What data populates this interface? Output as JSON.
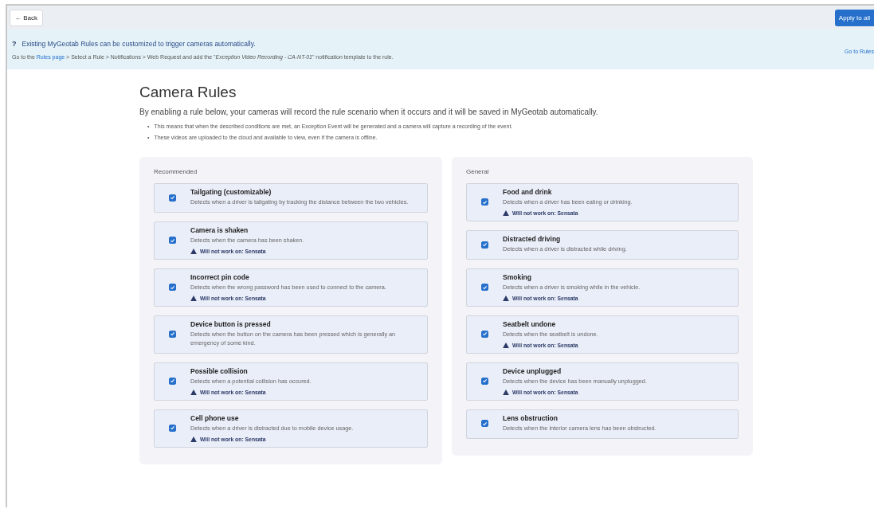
{
  "toolbar": {
    "back_button": "← Back",
    "apply_button": "Apply to all"
  },
  "banner": {
    "icon": "?",
    "headline": "Existing MyGeotab Rules can be customized to trigger cameras automatically.",
    "text_before": "Go to the ",
    "link": "Rules page",
    "text_after": " > Select a Rule > Notifications > Web Request and add the \"*Exception Video Recording - CA-NT-01*\" notification template to the rule.",
    "action_link": "Go to Rules"
  },
  "title": "Camera Rules",
  "subtitle": "By enabling a rule below, your cameras will record the rule scenario when it occurs and it will be saved in MyGeotab automatically.",
  "bullet_marker": "•",
  "bullets": [
    "This means that when the described conditions are met, an Exception Event will be generated and a camera will capture a recording of the event.",
    "These videos are uploaded to the cloud and available to view, even if the camera is offline."
  ],
  "groups": [
    {
      "heading": "Recommended",
      "rules": [
        {
          "name": "Tailgating (customizable)",
          "description": "Detects when a driver is tailgating by tracking the distance between the two vehicles.",
          "checked": true
        },
        {
          "name": "Camera is shaken",
          "description": "Detects when the camera has been shaken.",
          "warning": "Will not work on: Sensata",
          "checked": true
        },
        {
          "name": "Incorrect pin code",
          "description": "Detects when the wrong password has been used to connect to the camera.",
          "warning": "Will not work on: Sensata",
          "checked": true
        },
        {
          "name": "Device button is pressed",
          "description": "Detects when the button on the camera has been pressed which is generally an emergency of some kind.",
          "checked": true
        },
        {
          "name": "Possible collision",
          "description": "Detects when a potential collision has occured.",
          "warning": "Will not work on: Sensata",
          "checked": true
        },
        {
          "name": "Cell phone use",
          "description": "Detects when a driver is distracted due to mobile device usage.",
          "warning": "Will not work on: Sensata",
          "checked": true
        }
      ]
    },
    {
      "heading": "General",
      "rules": [
        {
          "name": "Food and drink",
          "description": "Detects when a driver has been eating or drinking.",
          "warning": "Will not work on: Sensata",
          "checked": true
        },
        {
          "name": "Distracted driving",
          "description": "Detects when a driver is distracted while driving.",
          "checked": true
        },
        {
          "name": "Smoking",
          "description": "Detects when a driver is smoking while in the vehicle.",
          "warning": "Will not work on: Sensata",
          "checked": true
        },
        {
          "name": "Seatbelt undone",
          "description": "Detects when the seatbelt is undone.",
          "warning": "Will not work on: Sensata",
          "checked": true
        },
        {
          "name": "Device unplugged",
          "description": "Detects when the device has been manually unplugged.",
          "warning": "Will not work on: Sensata",
          "checked": true
        },
        {
          "name": "Lens obstruction",
          "description": "Detects when the interior camera lens has been obstructed.",
          "checked": true
        }
      ]
    }
  ]
}
